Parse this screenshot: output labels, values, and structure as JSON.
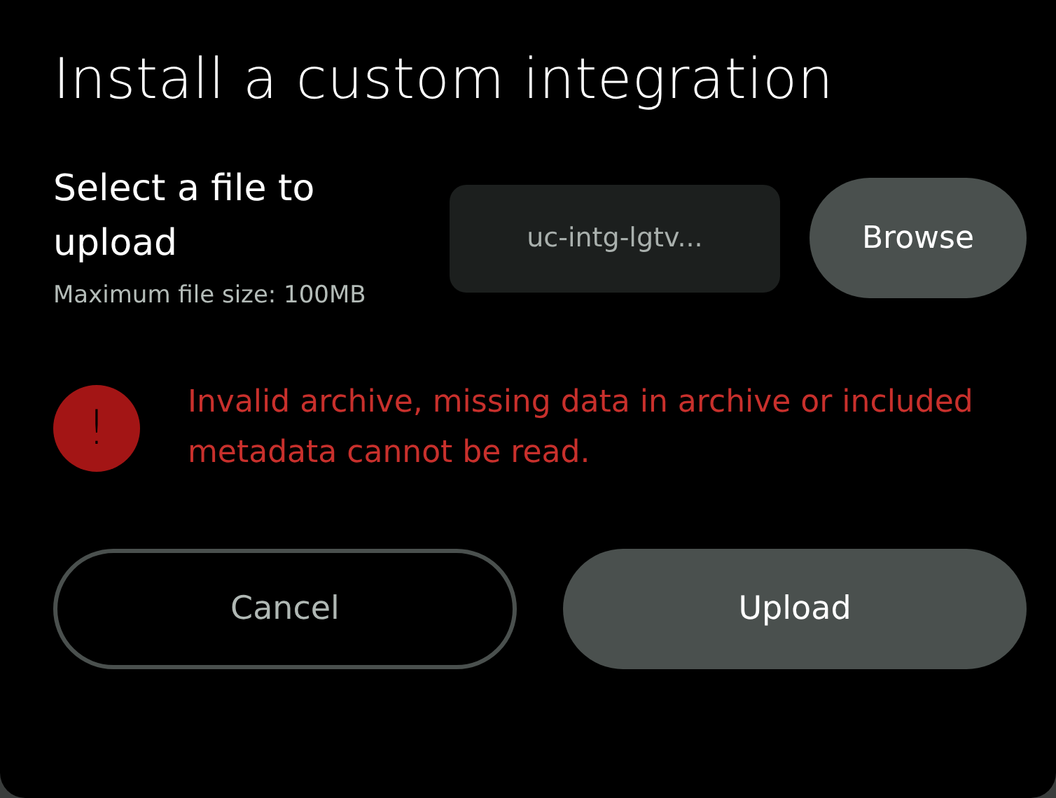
{
  "dialog": {
    "title": "Install a custom integration"
  },
  "file_section": {
    "label": "Select a file to upload",
    "hint": "Maximum file size: 100MB"
  },
  "file_field": {
    "value": "uc-intg-lgtv..."
  },
  "browse_button": {
    "label": "Browse"
  },
  "error": {
    "icon": "!",
    "message": "Invalid archive, missing data in archive or included metadata cannot be read."
  },
  "buttons": [
    {
      "label": "Cancel",
      "kind": "secondary"
    },
    {
      "label": "Upload",
      "kind": "primary"
    }
  ]
}
